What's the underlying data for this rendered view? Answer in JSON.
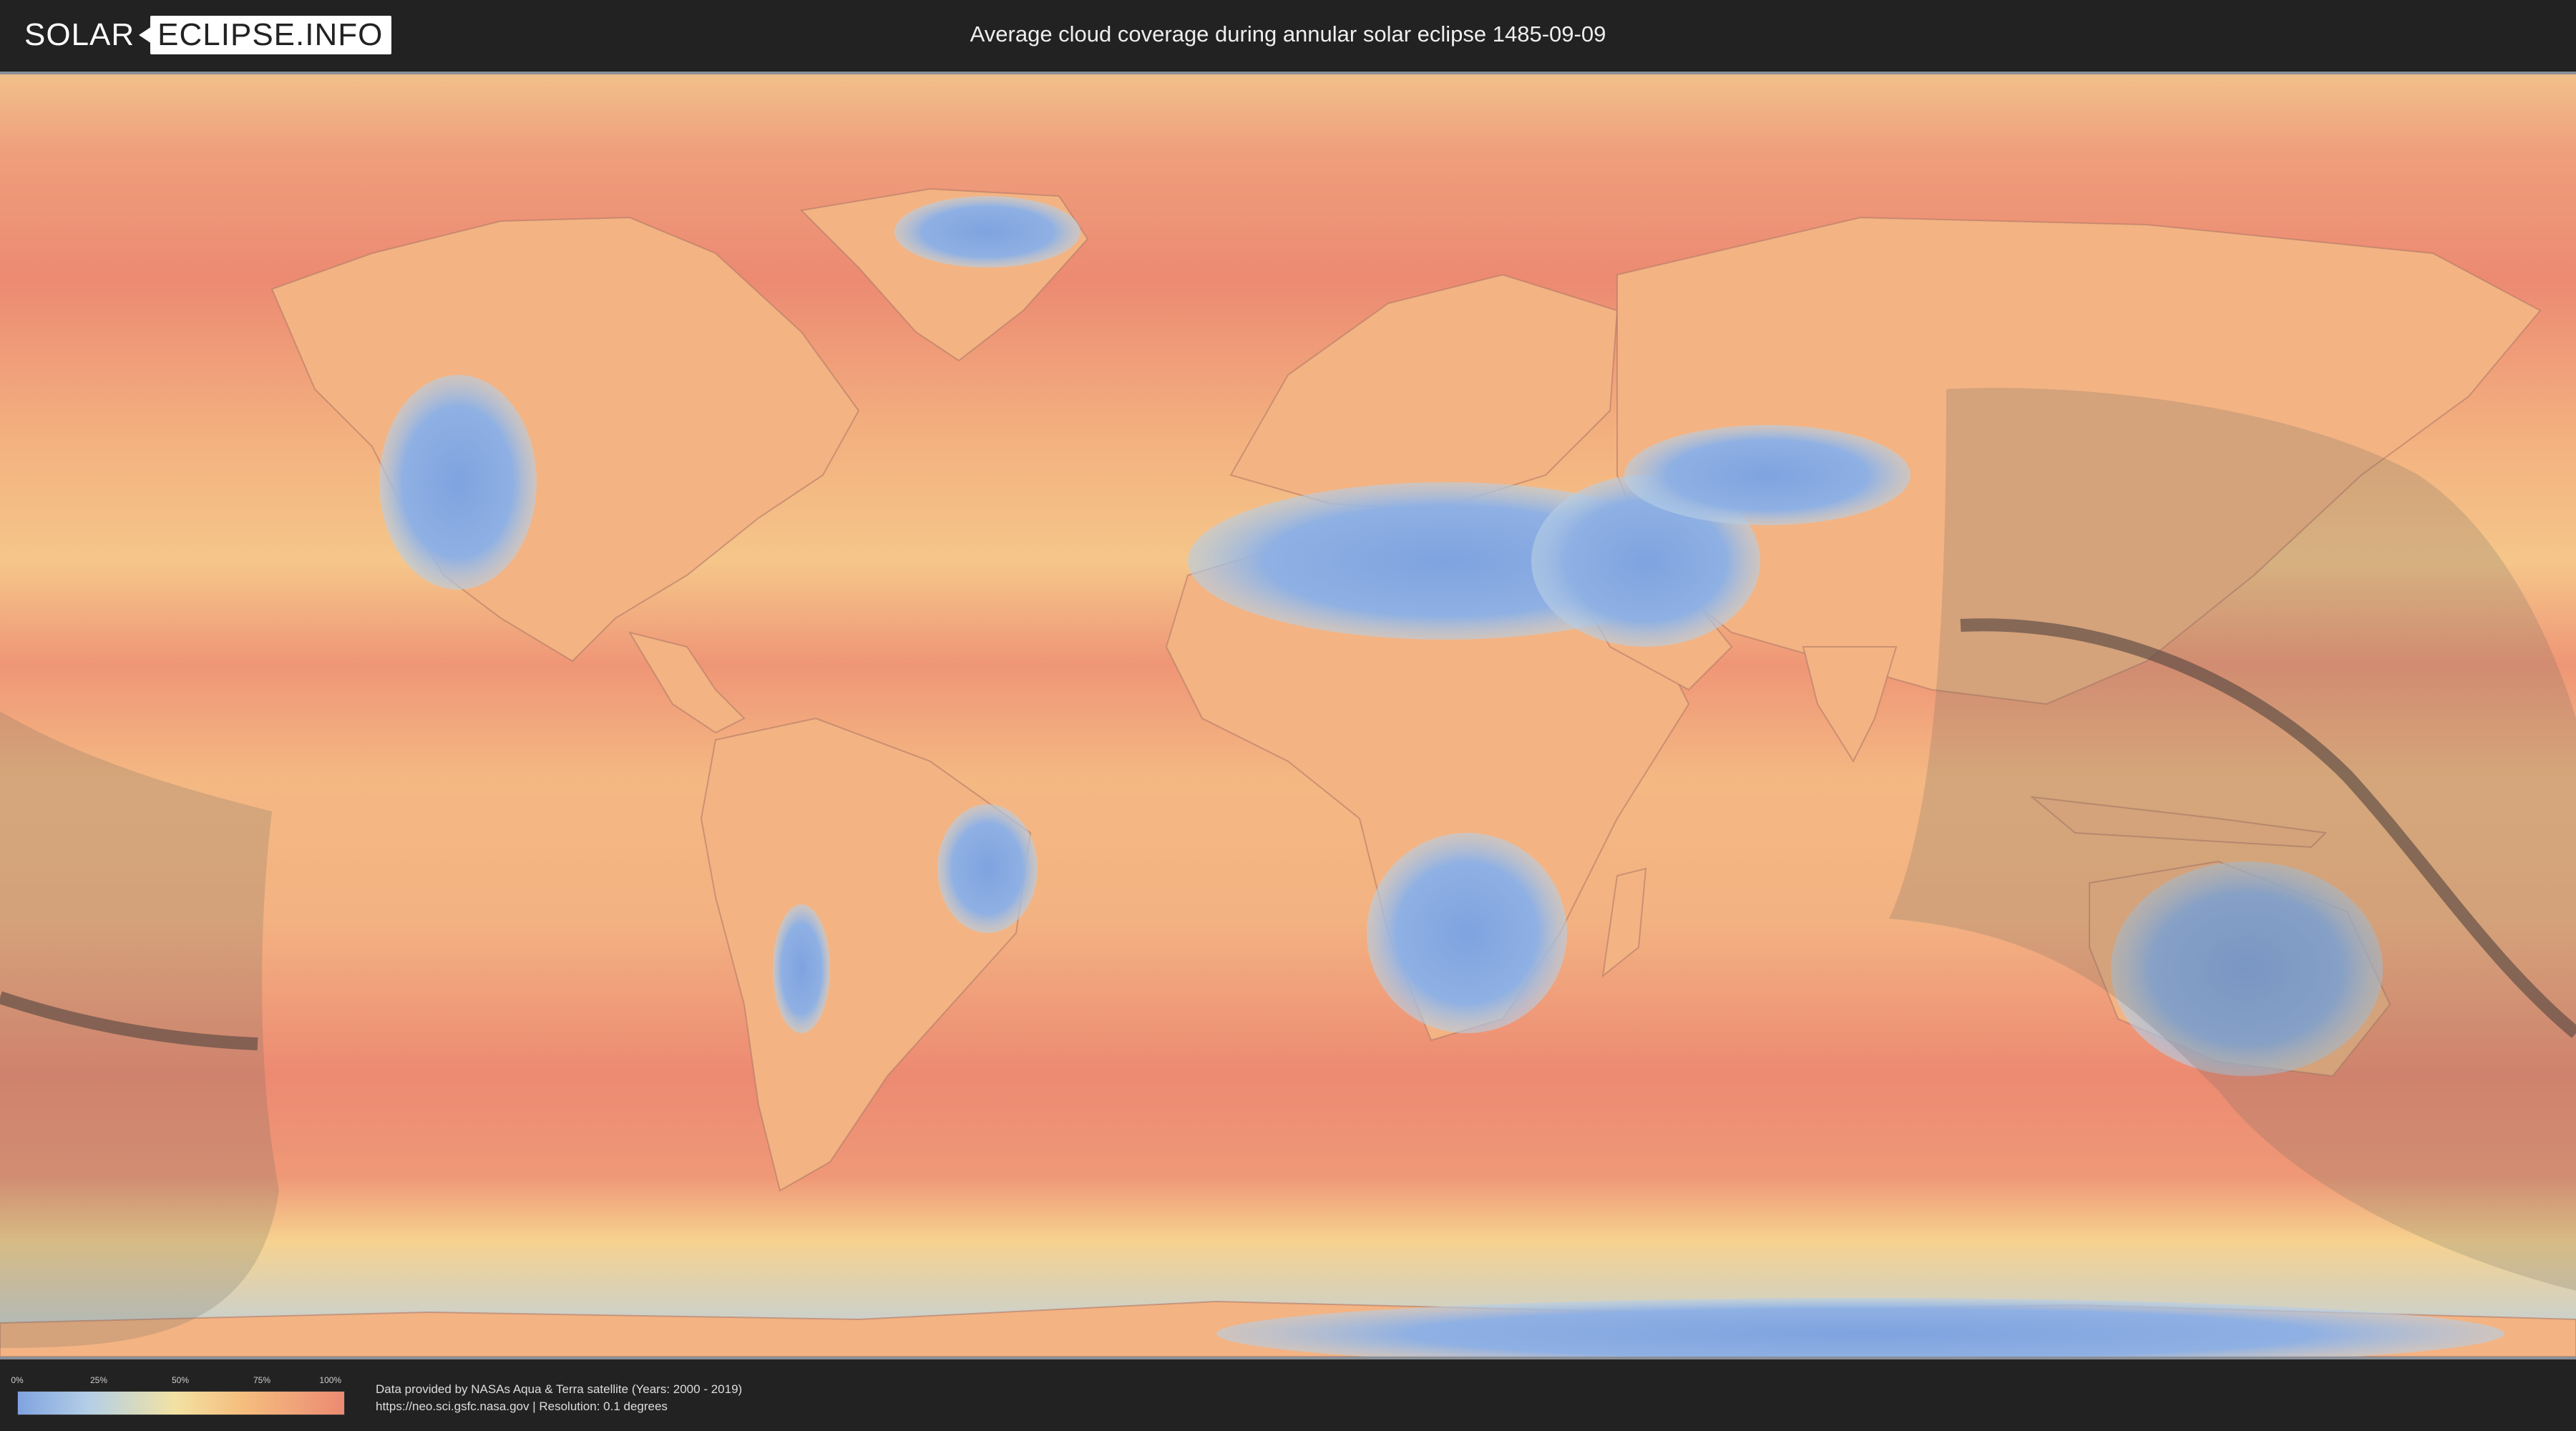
{
  "header": {
    "logo_left": "SOLAR",
    "logo_right": "ECLIPSE.INFO",
    "title": "Average cloud coverage during annular solar eclipse 1485-09-09"
  },
  "legend": {
    "ticks": [
      "0%",
      "25%",
      "50%",
      "75%",
      "100%"
    ],
    "colors": [
      "#7fa3e0",
      "#b5cfe6",
      "#f2e2a3",
      "#f5bf7f",
      "#ec8a72"
    ]
  },
  "footer": {
    "credit_line_1": "Data provided by NASAs Aqua & Terra satellite (Years: 2000 - 2019)",
    "credit_line_2": "https://neo.sci.gsfc.nasa.gov | Resolution: 0.1 degrees"
  },
  "map": {
    "projection": "equirectangular world map",
    "ocean_color": "#f0a878",
    "cloudy_color": "#ec8a72",
    "clear_color": "#86a8e2",
    "eclipse_shadow_color": "#6b6b5e"
  }
}
